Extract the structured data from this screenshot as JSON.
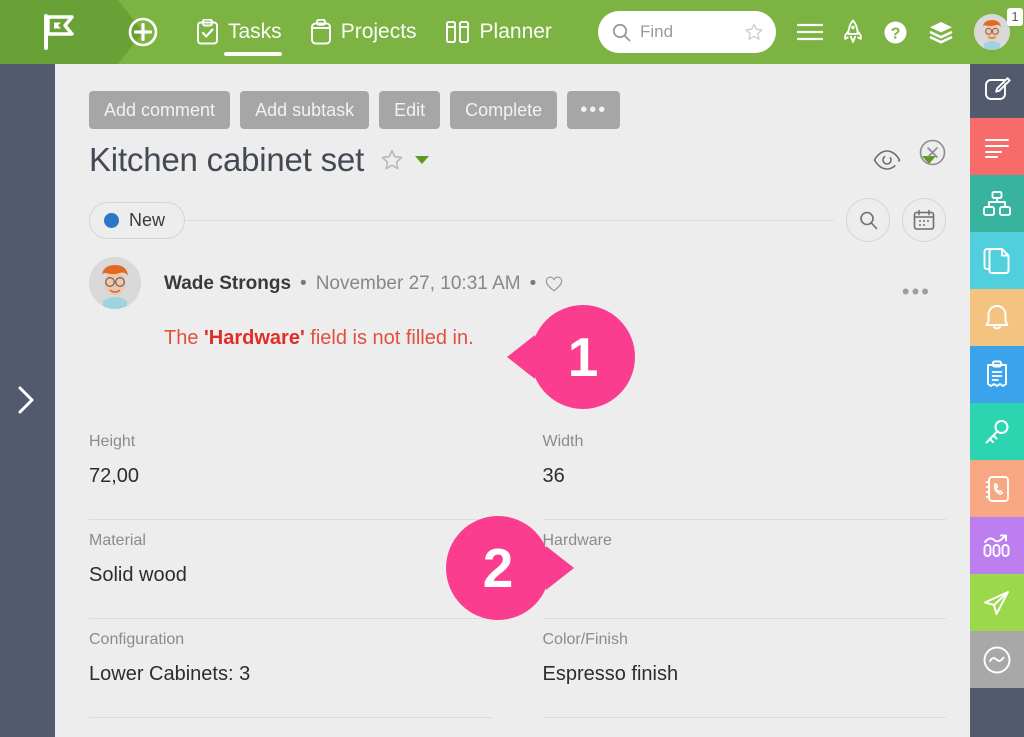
{
  "topbar": {
    "logo_icon": "flag-icon",
    "add_icon": "plus-circle-icon",
    "nav": [
      {
        "label": "Tasks",
        "icon": "clipboard-check-icon",
        "active": true
      },
      {
        "label": "Projects",
        "icon": "briefcase-icon",
        "active": false
      },
      {
        "label": "Planner",
        "icon": "columns-icon",
        "active": false
      }
    ],
    "search": {
      "placeholder": "Find",
      "icon": "search-icon",
      "star_icon": "star-outline-icon"
    },
    "icons": [
      {
        "name": "hamburger-menu-icon"
      },
      {
        "name": "rocket-icon"
      },
      {
        "name": "help-question-icon"
      },
      {
        "name": "layers-icon"
      }
    ],
    "avatar": {
      "name": "user-avatar",
      "notification_count": "1"
    },
    "background_color": "#7cb342",
    "logo_background_color": "#6aa136"
  },
  "left_rail": {
    "expand_icon": "chevron-right-icon",
    "background_color": "#545a6e"
  },
  "right_rail": {
    "items": [
      {
        "name": "edit-pencil-icon",
        "color": "#545a6e"
      },
      {
        "name": "feed-lines-icon",
        "color": "#f86b6b"
      },
      {
        "name": "sitemap-icon",
        "color": "#37b3a0"
      },
      {
        "name": "copy-documents-icon",
        "color": "#52cfdd"
      },
      {
        "name": "bell-icon",
        "color": "#f4c380"
      },
      {
        "name": "clipboard-icon",
        "color": "#3ba3ec"
      },
      {
        "name": "key-icon",
        "color": "#2dd4b0"
      },
      {
        "name": "phone-contacts-icon",
        "color": "#f7a781"
      },
      {
        "name": "analytics-chart-icon",
        "color": "#bd7ef0"
      },
      {
        "name": "paper-plane-icon",
        "color": "#9bd84b"
      },
      {
        "name": "tilde-circle-icon",
        "color": "#a8a8a8"
      }
    ]
  },
  "panel": {
    "close_icon": "close-circle-icon",
    "toolbar": [
      {
        "label": "Add comment",
        "name": "add-comment-button"
      },
      {
        "label": "Add subtask",
        "name": "add-subtask-button"
      },
      {
        "label": "Edit",
        "name": "edit-button"
      },
      {
        "label": "Complete",
        "name": "complete-button"
      },
      {
        "label": "•••",
        "name": "more-actions-button"
      }
    ],
    "title": "Kitchen cabinet set",
    "title_star_icon": "star-outline-icon",
    "title_caret_icon": "caret-down-icon",
    "eye_icon": "eye-visibility-icon",
    "eye_caret_icon": "caret-down-icon",
    "status": {
      "label": "New",
      "dot_color": "#2a77c8"
    },
    "search_circle_icon": "search-icon",
    "calendar_circle_icon": "calendar-icon"
  },
  "comment": {
    "author": "Wade Strongs",
    "separator": "•",
    "date": "November 27, 10:31 AM",
    "like_icon": "heart-outline-icon",
    "more_icon": "ellipsis-icon",
    "text_before": "The ",
    "text_bold": "'Hardware'",
    "text_after": " field is not filled in.",
    "text_color": "#e0503f"
  },
  "fields": [
    {
      "label": "Height",
      "value": "72,00"
    },
    {
      "label": "Width",
      "value": "36"
    },
    {
      "label": "Material",
      "value": "Solid wood"
    },
    {
      "label": "Hardware",
      "value": ""
    },
    {
      "label": "Configuration",
      "value": "Lower Cabinets: 3"
    },
    {
      "label": "Color/Finish",
      "value": "Espresso finish"
    }
  ],
  "callouts": [
    {
      "number": "1",
      "tail": "left"
    },
    {
      "number": "2",
      "tail": "right"
    }
  ]
}
